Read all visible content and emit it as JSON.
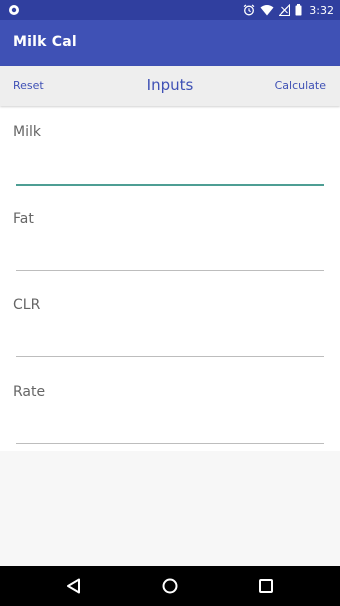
{
  "status_bar": {
    "time": "3:32",
    "icons": [
      "notification-dot-icon",
      "alarm-icon",
      "wifi-icon",
      "signal-icon",
      "battery-icon"
    ]
  },
  "app_bar": {
    "title": "Milk Cal"
  },
  "toolbar": {
    "reset_label": "Reset",
    "title": "Inputs",
    "calculate_label": "Calculate"
  },
  "form": {
    "fields": [
      {
        "label": "Milk",
        "value": ""
      },
      {
        "label": "Fat",
        "value": ""
      },
      {
        "label": "CLR",
        "value": ""
      },
      {
        "label": "Rate",
        "value": ""
      }
    ]
  },
  "nav_bar": {
    "icons": [
      "back-icon",
      "home-icon",
      "recents-icon"
    ]
  },
  "colors": {
    "status_bar": "#303f9f",
    "app_bar": "#3f51b5",
    "accent": "#4d9e94",
    "toolbar_text": "#3f51b5"
  }
}
